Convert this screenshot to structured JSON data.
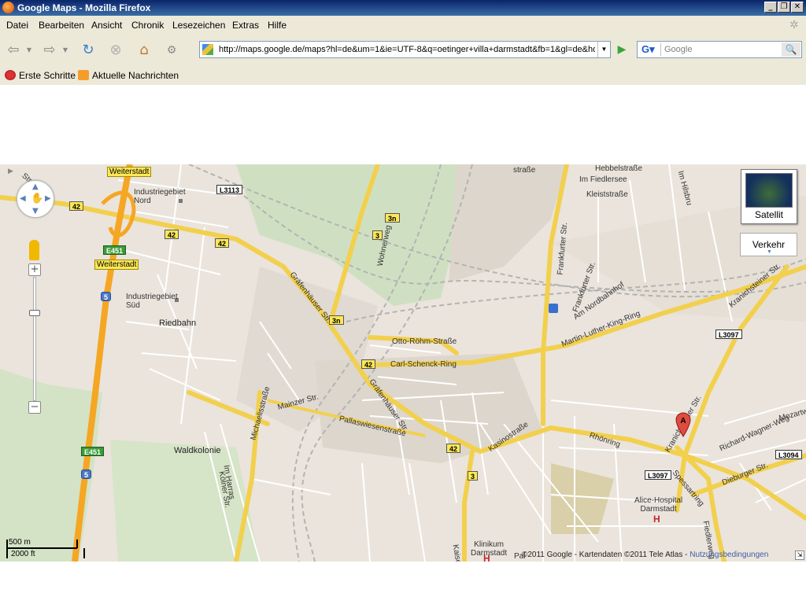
{
  "window": {
    "title": "Google Maps - Mozilla Firefox"
  },
  "menu": {
    "items": [
      "Datei",
      "Bearbeiten",
      "Ansicht",
      "Chronik",
      "Lesezeichen",
      "Extras",
      "Hilfe"
    ]
  },
  "toolbar": {
    "url": "http://maps.google.de/maps?hl=de&um=1&ie=UTF-8&q=oetinger+villa+darmstadt&fb=1&gl=de&hq=oe",
    "search_placeholder": "Google"
  },
  "bookmarks": {
    "items": [
      "Erste Schritte",
      "Aktuelle Nachrichten"
    ]
  },
  "map": {
    "controls": {
      "satellite_label": "Satellit",
      "traffic_label": "Verkehr"
    },
    "scale": {
      "metric": "500 m",
      "imperial": "2000 ft"
    },
    "copyright": "©2011 Google - Kartendaten ©2011 Tele Atlas - ",
    "terms_link": "Nutzungsbedingungen",
    "marker_letter": "A",
    "labels": {
      "weiterstadt1": "Weiterstadt",
      "weiterstadt2": "Weiterstadt",
      "ind_nord": "Industriegebiet\nNord",
      "ind_sued": "Industriegebiet\nSüd",
      "riedbahn": "Riedbahn",
      "waldkolonie": "Waldkolonie",
      "hebbel": "Hebbelstraße",
      "fiedler": "Im Fiedlersee",
      "kleist": "Kleiststraße",
      "hilsbru": "Im Hilsbru",
      "frankfurter": "Frankfurter Str.",
      "frankfurter2": "Frankfurter Str.",
      "nordbahnhof": "Am Nordbahnhof",
      "mlk": "Martin-Luther-King-Ring",
      "kranich1": "Kranichsteiner Str.",
      "kranich2": "Kranichsteiner Str.",
      "richard": "Richard-Wagner-Weg",
      "mozart": "Mozartw",
      "dieburger": "Dieburger Str.",
      "spessart": "Spessartring",
      "fiedlerweg": "Fiedlerweg",
      "rhoenring": "Rhönring",
      "kasino": "Kasinostraße",
      "alice": "Alice-Hospital\nDarmstadt",
      "klinikum": "Klinikum\nDarmstadt",
      "pallas": "Pallaswiesenstraße",
      "mainzer": "Mainzer Str.",
      "michaelis": "Michaelisstraße",
      "harras": "Im Harras",
      "koelner": "Kölner Str.",
      "graef1": "Gräfenhäuser Str.",
      "graef2": "Gräfenhäuser Str.",
      "otto": "Otto-Röhm-Straße",
      "carl": "Carl-Schenck-Ring",
      "wohnerweg": "Wohnerweg",
      "strasse_top": "straße",
      "str_left": "Str.",
      "kaiser": "Kaiser",
      "pal": "Pal"
    },
    "shields": {
      "l3113": "L3113",
      "r42a": "42",
      "r42b": "42",
      "r42c": "42",
      "r42d": "42",
      "r42e": "42",
      "r3n_a": "3n",
      "r3a": "3",
      "r3n_b": "3n",
      "r3b": "3",
      "e451a": "E451",
      "e451b": "E451",
      "r5a": "5",
      "r5b": "5",
      "l3097a": "L3097",
      "l3097b": "L3097",
      "l3094": "L3094"
    }
  }
}
